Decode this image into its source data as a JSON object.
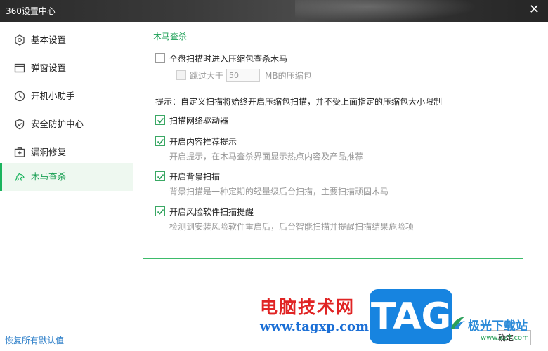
{
  "window": {
    "title": "360设置中心",
    "close_glyph": "✕"
  },
  "sidebar": {
    "items": [
      {
        "label": "基本设置",
        "icon": "hexagon-settings-icon",
        "active": false
      },
      {
        "label": "弹窗设置",
        "icon": "window-icon",
        "active": false
      },
      {
        "label": "开机小助手",
        "icon": "clock-icon",
        "active": false
      },
      {
        "label": "安全防护中心",
        "icon": "shield-icon",
        "active": false
      },
      {
        "label": "漏洞修复",
        "icon": "patch-plus-icon",
        "active": false
      },
      {
        "label": "木马查杀",
        "icon": "horse-icon",
        "active": true
      }
    ],
    "restore_defaults": "恢复所有默认值"
  },
  "trojan_section": {
    "legend": "木马查杀",
    "compressed_scan": {
      "label": "全盘扫描时进入压缩包查杀木马",
      "checked": false
    },
    "skip_larger": {
      "prefix": "跳过大于",
      "value": "50",
      "suffix": "MB的压缩包",
      "checked": false,
      "disabled": true
    },
    "hint": "提示：自定义扫描将始终开启压缩包扫描，并不受上面指定的压缩包大小限制",
    "options": [
      {
        "label": "扫描网络驱动器",
        "checked": true,
        "desc": ""
      },
      {
        "label": "开启内容推荐提示",
        "checked": true,
        "desc": "开启提示，在木马查杀界面显示热点内容及产品推荐"
      },
      {
        "label": "开启背景扫描",
        "checked": true,
        "desc": "背景扫描是一种定期的轻量级后台扫描，主要扫描顽固木马"
      },
      {
        "label": "开启风险软件扫描提醒",
        "checked": true,
        "desc": "检测到安装风险软件重启后，后台智能扫描并提醒扫描结果危险项"
      }
    ]
  },
  "footer": {
    "ok_label": "确定"
  },
  "watermark": {
    "site_name": "电脑技术网",
    "url": "www.tagxp.com",
    "tag": "TAG",
    "brand": "极光下载站",
    "brand_url": "www.xz7.com"
  },
  "colors": {
    "accent": "#1bb45e",
    "border_green": "#3dbb6a",
    "link_blue": "#2a7dc8",
    "titlebar": "#333333"
  }
}
